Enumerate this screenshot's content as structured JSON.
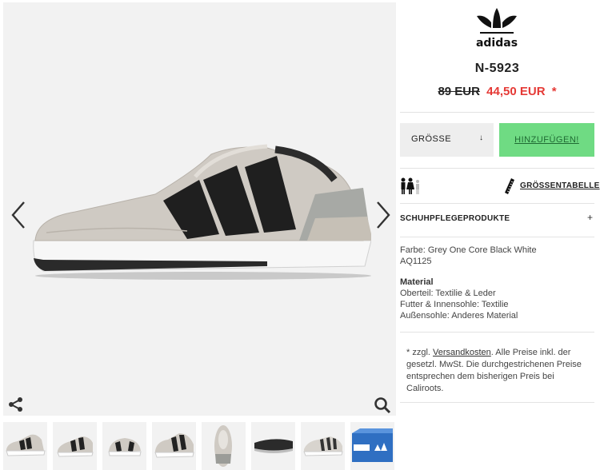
{
  "product": {
    "brand": "adidas",
    "name": "N-5923",
    "old_price": "89 EUR",
    "new_price": "44,50 EUR",
    "price_mark": "*"
  },
  "actions": {
    "size_label": "GRÖSSE",
    "add_label": "HINZUFÜGEN!",
    "size_table_label": "GRÖSSENTABELLE",
    "care_label": "SCHUHPFLEGEPRODUKTE",
    "care_toggle": "+"
  },
  "details": {
    "color": "Farbe: Grey One Core Black White",
    "sku": "AQ1125",
    "material_heading": "Material",
    "upper": "Oberteil: Textilie & Leder",
    "lining": "Futter & Innensohle: Textilie",
    "outsole": "Außensohle: Anderes Material"
  },
  "note": {
    "prefix": "* zzgl. ",
    "link": "Versandkosten",
    "suffix": ". Alle Preise inkl. der gesetzl. MwSt. Die durchgestrichenen Preise entsprechen dem bisherigen Preis bei Caliroots."
  },
  "icons": {
    "prev": "chevron-left-icon",
    "next": "chevron-right-icon",
    "share": "share-icon",
    "zoom": "search-icon",
    "size_guide": "people-icon",
    "ruler": "ruler-icon"
  },
  "colors": {
    "add_button": "#6fdb83",
    "sale_price": "#e53935",
    "gallery_bg": "#f2f2f2"
  }
}
